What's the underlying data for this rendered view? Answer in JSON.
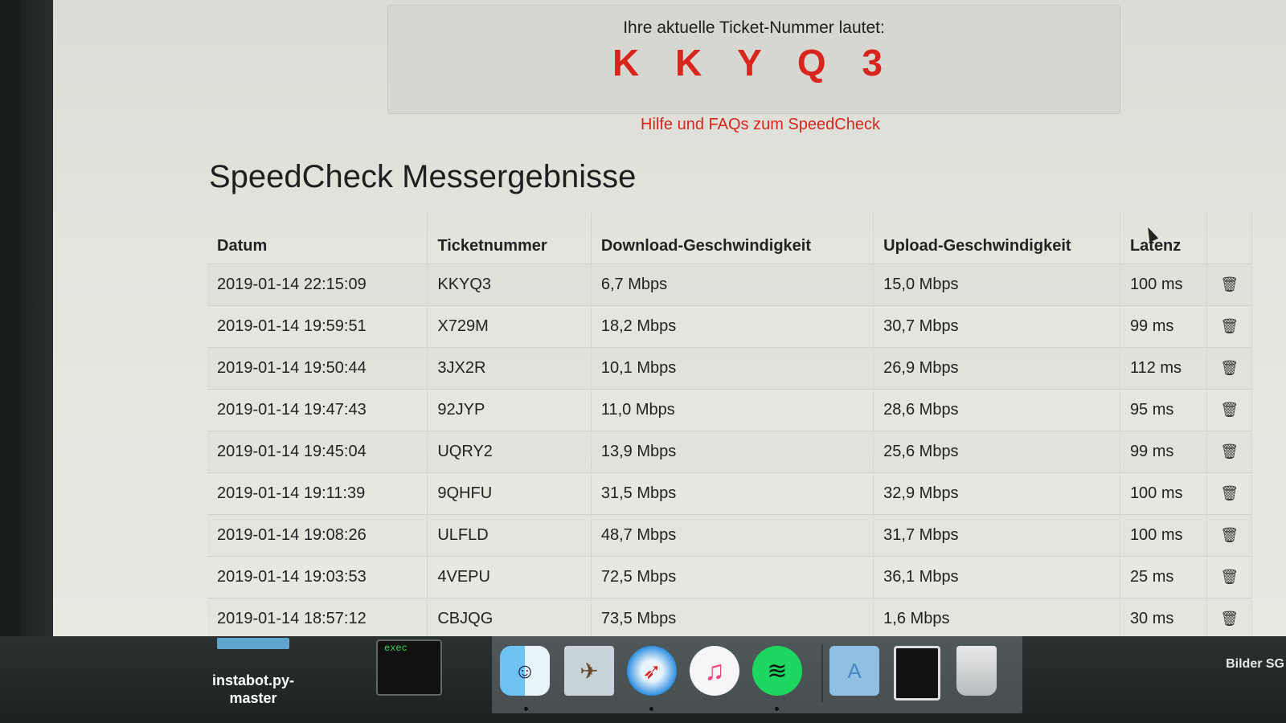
{
  "ticket": {
    "label": "Ihre aktuelle Ticket-Nummer lautet:",
    "number": "K K Y Q 3"
  },
  "help_link": "Hilfe und FAQs zum SpeedCheck",
  "section_title": "SpeedCheck Messergebnisse",
  "table": {
    "headers": [
      "Datum",
      "Ticketnummer",
      "Download-Geschwindigkeit",
      "Upload-Geschwindigkeit",
      "Latenz",
      ""
    ],
    "rows": [
      [
        "2019-01-14 22:15:09",
        "KKYQ3",
        "6,7 Mbps",
        "15,0 Mbps",
        "100 ms"
      ],
      [
        "2019-01-14 19:59:51",
        "X729M",
        "18,2 Mbps",
        "30,7 Mbps",
        "99 ms"
      ],
      [
        "2019-01-14 19:50:44",
        "3JX2R",
        "10,1 Mbps",
        "26,9 Mbps",
        "112 ms"
      ],
      [
        "2019-01-14 19:47:43",
        "92JYP",
        "11,0 Mbps",
        "28,6 Mbps",
        "95 ms"
      ],
      [
        "2019-01-14 19:45:04",
        "UQRY2",
        "13,9 Mbps",
        "25,6 Mbps",
        "99 ms"
      ],
      [
        "2019-01-14 19:11:39",
        "9QHFU",
        "31,5 Mbps",
        "32,9 Mbps",
        "100 ms"
      ],
      [
        "2019-01-14 19:08:26",
        "ULFLD",
        "48,7 Mbps",
        "31,7 Mbps",
        "100 ms"
      ],
      [
        "2019-01-14 19:03:53",
        "4VEPU",
        "72,5 Mbps",
        "36,1 Mbps",
        "25 ms"
      ],
      [
        "2019-01-14 18:57:12",
        "CBJQG",
        "73,5 Mbps",
        "1,6 Mbps",
        "30 ms"
      ]
    ],
    "delete_icon": "trash-icon"
  },
  "desktop": {
    "folder_label": "instabot.py-\nmaster",
    "right_label": "Bilder SG",
    "exec_label": "exec"
  },
  "dock": {
    "items": [
      "finder-icon",
      "mail-icon",
      "safari-icon",
      "itunes-icon",
      "spotify-icon",
      "appstore-folder-icon",
      "terminal-icon",
      "trash-icon"
    ]
  },
  "colors": {
    "accent": "#d8251d"
  }
}
